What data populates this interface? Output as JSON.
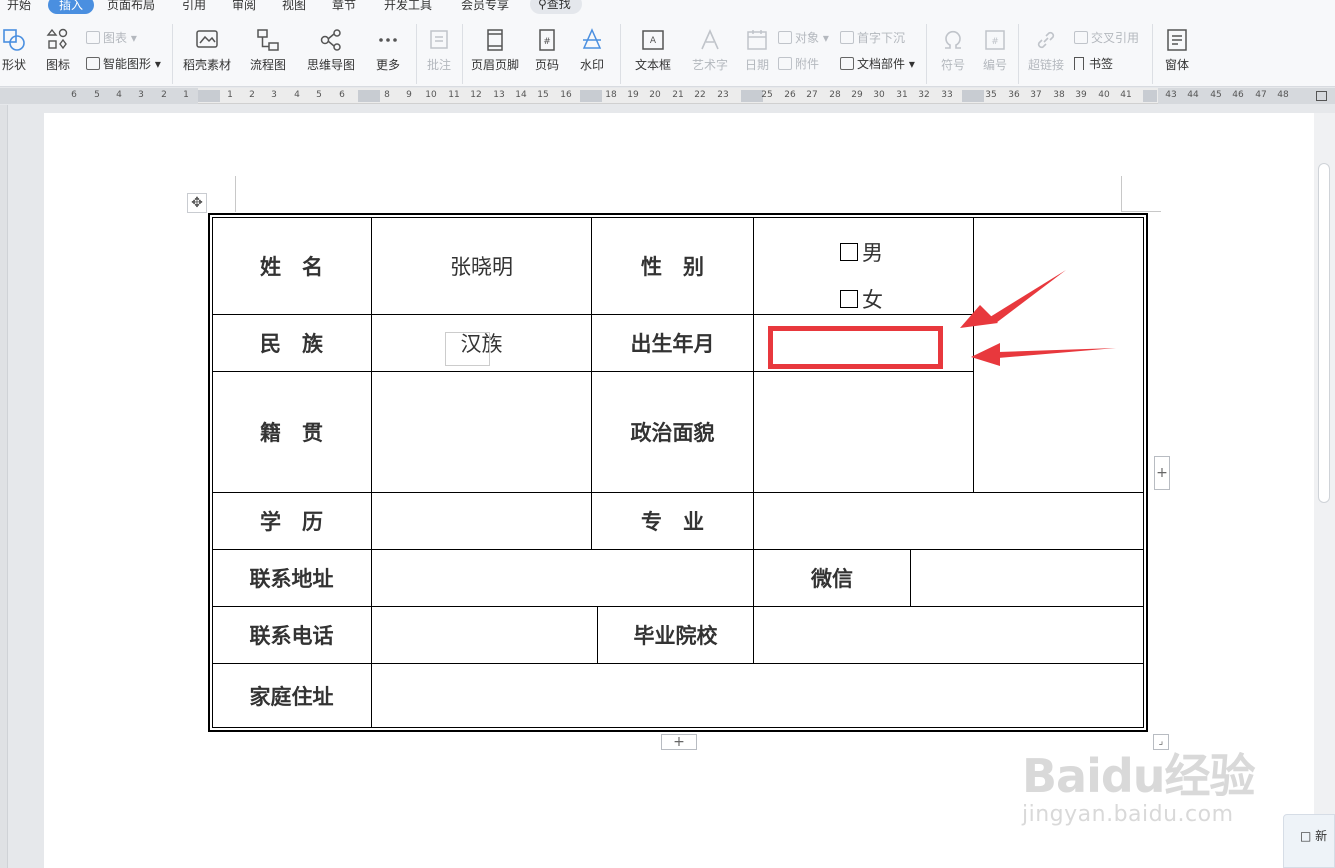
{
  "menu": {
    "tabs": [
      "开始",
      "插入",
      "页面布局",
      "引用",
      "审阅",
      "视图",
      "章节",
      "开发工具",
      "会员专享"
    ],
    "active_tab": "插入",
    "search_label": "查找"
  },
  "ribbon": {
    "shape": "形状",
    "icon": "图标",
    "chart": "图表",
    "smart_shape": "智能图形",
    "material": "稻壳素材",
    "flowchart": "流程图",
    "mindmap": "思维导图",
    "more": "更多",
    "comment": "批注",
    "header_footer": "页眉页脚",
    "page_num": "页码",
    "watermark": "水印",
    "textbox": "文本框",
    "wordart": "艺术字",
    "date": "日期",
    "object": "对象",
    "attachment": "附件",
    "dropcap": "首字下沉",
    "docparts": "文档部件",
    "symbol": "符号",
    "numbering": "编号",
    "hyperlink": "超链接",
    "crossref": "交叉引用",
    "bookmark": "书签",
    "window": "窗体"
  },
  "ruler": {
    "left_numbers": [
      "6",
      "5",
      "4",
      "3",
      "2",
      "1"
    ],
    "right_numbers": [
      "1",
      "2",
      "3",
      "4",
      "5",
      "6",
      "8",
      "9",
      "10",
      "11",
      "12",
      "13",
      "14",
      "15",
      "16",
      "18",
      "19",
      "20",
      "21",
      "22",
      "23",
      "25",
      "26",
      "27",
      "28",
      "29",
      "30",
      "31",
      "32",
      "33",
      "35",
      "36",
      "37",
      "38",
      "39",
      "40",
      "41",
      "43",
      "44",
      "45",
      "46",
      "47",
      "48"
    ]
  },
  "table": {
    "name_label": "姓　名",
    "name_value": "张晓明",
    "gender_label": "性　别",
    "gender_male": "男",
    "gender_female": "女",
    "ethnicity_label": "民　族",
    "ethnicity_value": "汉族",
    "birth_label": "出生年月",
    "birth_value": "",
    "native_label": "籍　贯",
    "political_label": "政治面貌",
    "education_label": "学　历",
    "major_label": "专　业",
    "address_label": "联系地址",
    "wechat_label": "微信",
    "phone_label": "联系电话",
    "school_label": "毕业院校",
    "home_label": "家庭住址"
  },
  "watermark": {
    "main": "Baidu经验",
    "sub": "jingyan.baidu.com"
  },
  "chat_popup": {
    "label": "新"
  },
  "colors": {
    "accent": "#4a8fe0",
    "highlight": "#e8383d"
  }
}
